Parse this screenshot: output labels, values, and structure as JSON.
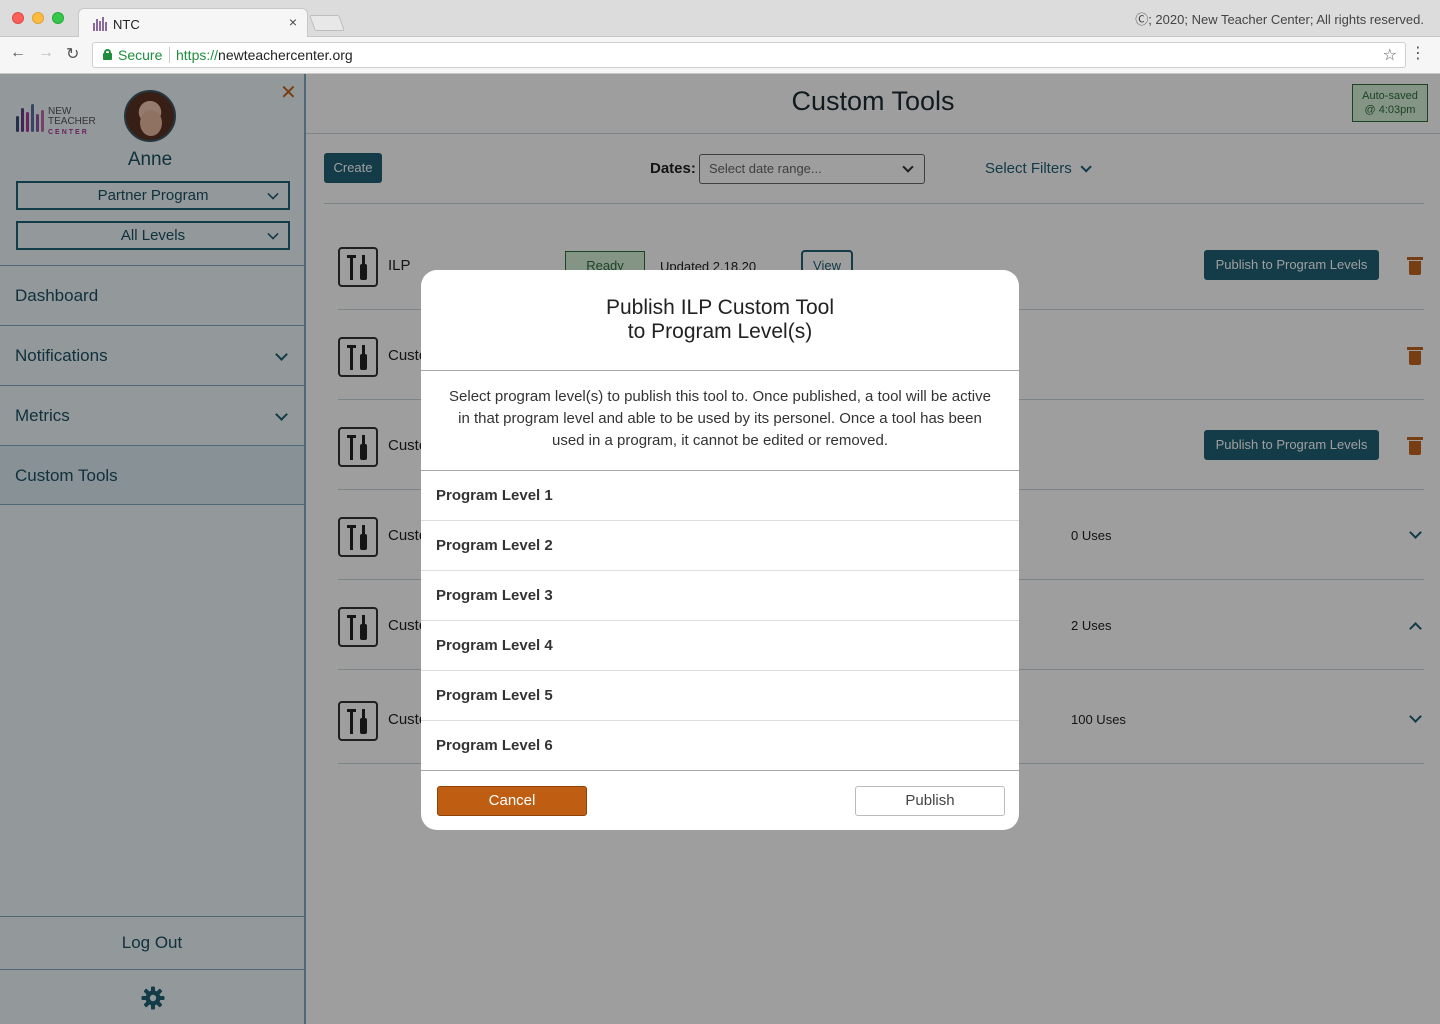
{
  "browser": {
    "tab_title": "NTC",
    "tab_close": "×",
    "copyright": "Ⓒ; 2020; New Teacher Center; All rights reserved.",
    "back": "←",
    "forward": "→",
    "reload": "↻",
    "secure_label": "Secure",
    "url_scheme": "https://",
    "url_host": "newteachercenter.org",
    "bookmark": "☆",
    "menu": "⋮"
  },
  "sidebar": {
    "close": "✕",
    "logo_line1": "NEW TEACHER",
    "logo_line2": "CENTER",
    "user_name": "Anne",
    "program_select": "Partner Program",
    "levels_select": "All Levels",
    "nav": [
      {
        "label": "Dashboard",
        "has_chevron": false
      },
      {
        "label": "Notifications",
        "has_chevron": true
      },
      {
        "label": "Metrics",
        "has_chevron": true
      },
      {
        "label": "Custom Tools",
        "has_chevron": false,
        "active": true
      }
    ],
    "logout": "Log Out",
    "settings_icon": "gear-icon"
  },
  "main": {
    "title": "Custom Tools",
    "autosave_line1": "Auto-saved",
    "autosave_line2": "@ 4:03pm",
    "create": "Create",
    "dates_label": "Dates:",
    "dates_placeholder": "Select date range...",
    "filters": "Select Filters",
    "rows": [
      {
        "name": "ILP",
        "status": "Ready",
        "updated": "Updated 2.18.20",
        "view": "View",
        "publish": "Publish to Program Levels",
        "uses": "",
        "chevron": ""
      },
      {
        "name": "Custo",
        "status": "",
        "updated": "",
        "view": "",
        "publish": "",
        "uses": "",
        "chevron": ""
      },
      {
        "name": "Custo",
        "status": "",
        "updated": "",
        "view": "",
        "publish": "Publish to Program Levels",
        "uses": "",
        "chevron": ""
      },
      {
        "name": "Custo",
        "status": "",
        "updated": "",
        "view": "",
        "publish": "",
        "uses": "0 Uses",
        "chevron": "down"
      },
      {
        "name": "Custo",
        "status": "",
        "updated": "",
        "view": "",
        "publish": "",
        "uses": "2 Uses",
        "chevron": "up"
      },
      {
        "name": "Custo",
        "status": "",
        "updated": "",
        "view": "",
        "publish": "",
        "uses": "100 Uses",
        "chevron": "down"
      }
    ]
  },
  "modal": {
    "title_line1": "Publish ILP Custom Tool",
    "title_line2": "to Program Level(s)",
    "description": "Select program level(s) to publish this tool to. Once published, a tool will be active in that program level and able to be used by its personel. Once a tool has been used in a program, it cannot be edited or removed.",
    "levels": [
      "Program Level 1",
      "Program Level 2",
      "Program Level 3",
      "Program Level 4",
      "Program Level 5",
      "Program Level 6"
    ],
    "cancel": "Cancel",
    "publish": "Publish"
  },
  "colors": {
    "primary": "#1f6075",
    "accent_orange": "#bf5e12",
    "ready_green": "#2f6d3c",
    "sidebar_bg": "#eef5f9"
  }
}
